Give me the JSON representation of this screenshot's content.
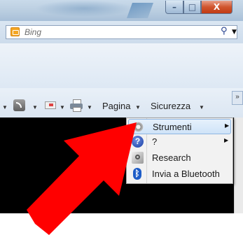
{
  "search": {
    "placeholder": "Bing",
    "go_icon": "⚲",
    "dropdown_icon": "▼"
  },
  "window": {
    "min_glyph": "–",
    "max_glyph": "□",
    "close_glyph": "X"
  },
  "command_bar": {
    "page_label": "Pagina",
    "safety_label": "Sicurezza",
    "caret": "▼",
    "overflow": "»"
  },
  "tools_menu": {
    "items": [
      {
        "label": "Strumenti",
        "icon": "gear-icon",
        "submenu": true
      },
      {
        "label": "?",
        "icon": "help-icon",
        "submenu": true
      },
      {
        "label": "Research",
        "icon": "research-icon",
        "submenu": false
      },
      {
        "label": "Invia a Bluetooth",
        "icon": "bluetooth-icon",
        "submenu": false
      }
    ],
    "submenu_arrow": "▶"
  },
  "colors": {
    "arrow": "#ff0000",
    "highlight": "#cfe3f8",
    "video": "#000000"
  }
}
